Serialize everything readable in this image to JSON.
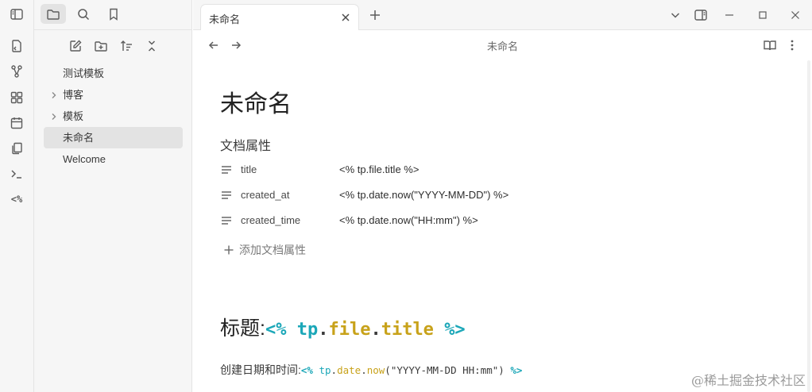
{
  "tabs": [
    {
      "label": "未命名"
    }
  ],
  "view": {
    "title": "未命名"
  },
  "file_tree": [
    {
      "label": "测试模板",
      "folder": false
    },
    {
      "label": "博客",
      "folder": true
    },
    {
      "label": "模板",
      "folder": true
    },
    {
      "label": "未命名",
      "folder": false,
      "active": true
    },
    {
      "label": "Welcome",
      "folder": false
    }
  ],
  "document": {
    "title": "未命名",
    "properties_heading": "文档属性",
    "properties": [
      {
        "key": "title",
        "value": "<% tp.file.title %>"
      },
      {
        "key": "created_at",
        "value": "<% tp.date.now(\"YYYY-MM-DD\") %>"
      },
      {
        "key": "created_time",
        "value": "<% tp.date.now(\"HH:mm\") %>"
      }
    ],
    "add_property": "添加文档属性",
    "heading": {
      "label": "标题",
      "colon": ": ",
      "code": {
        "open": "<%",
        "obj": "tp",
        "dot1": ".",
        "mod": "file",
        "dot2": ".",
        "fn": "title",
        "close": "%>"
      }
    },
    "paragraph": {
      "label": "创建日期和时间",
      "colon": ": ",
      "code": {
        "open": "<%",
        "obj": "tp",
        "dot1": ".",
        "mod": "date",
        "dot2": ".",
        "fn": "now",
        "args": "(\"YYYY-MM-DD HH:mm\")",
        "close": "%>"
      }
    }
  },
  "watermark": "@稀土掘金技术社区",
  "colors": {
    "accent_teal": "#1ba7b8",
    "accent_gold": "#c8a21a",
    "active_bg": "#e3e3e3"
  }
}
